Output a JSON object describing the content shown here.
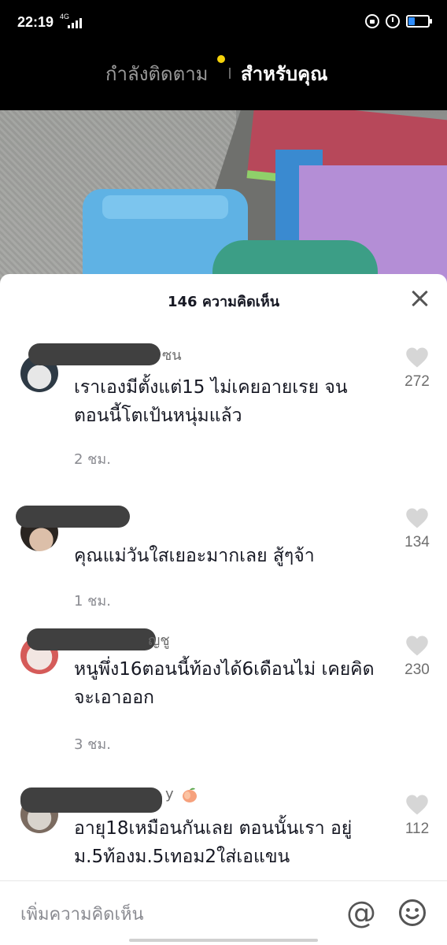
{
  "status_bar": {
    "time": "22:19",
    "network": "4G",
    "battery_fraction": 0.35,
    "icons": [
      "signal-icon",
      "lock-rotation-icon",
      "alarm-icon",
      "battery-icon"
    ]
  },
  "top_tabs": {
    "following": "กำลังติดตาม",
    "for_you": "สำหรับคุณ",
    "live_dot_color": "#f5d20a"
  },
  "comments_sheet": {
    "title": "146 ความคิดเห็น",
    "comments": [
      {
        "username_visible": "ซน",
        "text": "เราเองมีตั้งแต่15 ไม่เคยอายเรย จนตอนนี้โตเป้นหนุ่มแล้ว",
        "time": "2 ชม.",
        "likes": "272"
      },
      {
        "username_visible": "",
        "text": "คุณแม่วันใสเยอะมากเลย สู้ๆจ้า",
        "time": "1 ชม.",
        "likes": "134"
      },
      {
        "username_visible": "ญชู",
        "text": "หนูพึ่ง16ตอนนี้ท้องได้6เดือนไม่ เคยคิดจะเอาออก",
        "time": "3 ชม.",
        "likes": "230"
      },
      {
        "username_visible": "y",
        "text": "อายุ18เหมือนกันเลย ตอนนั้นเรา อยู่ม.5ท้องม.5เทอม2ใส่เอแขน",
        "time": "",
        "likes": "112"
      }
    ]
  },
  "input_bar": {
    "placeholder": "เพิ่มความคิดเห็น",
    "at_symbol": "@",
    "icons": [
      "at-icon",
      "emoji-icon"
    ]
  }
}
